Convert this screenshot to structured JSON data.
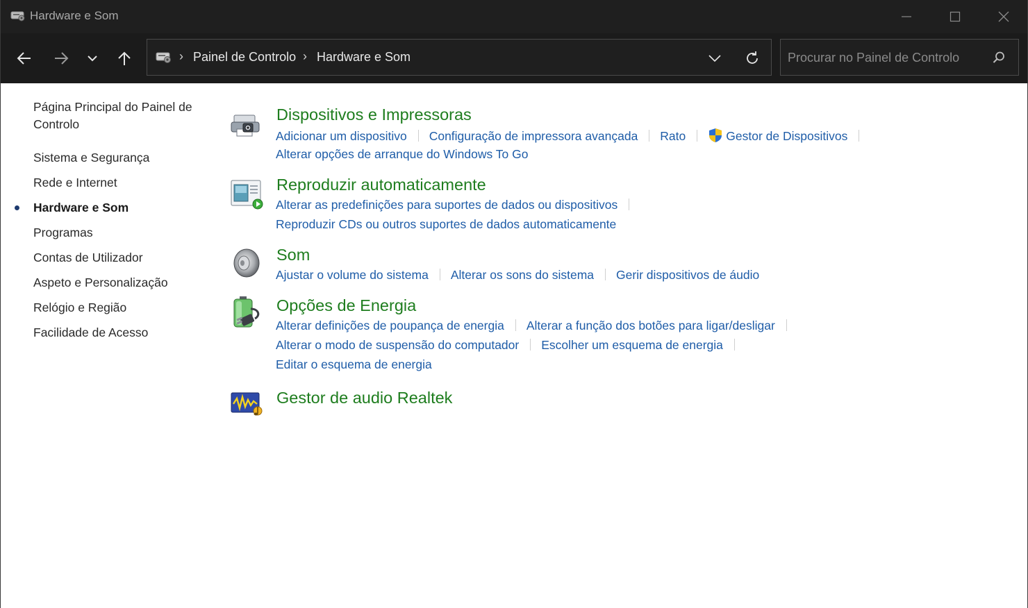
{
  "window": {
    "title": "Hardware e Som"
  },
  "address": {
    "crumbs": [
      "Painel de Controlo",
      "Hardware e Som"
    ],
    "separator": "›"
  },
  "search": {
    "placeholder": "Procurar no Painel de Controlo",
    "value": ""
  },
  "sidebar": {
    "home": "Página Principal do Painel de Controlo",
    "items": [
      {
        "label": "Sistema e Segurança",
        "active": false
      },
      {
        "label": "Rede e Internet",
        "active": false
      },
      {
        "label": "Hardware e Som",
        "active": true
      },
      {
        "label": "Programas",
        "active": false
      },
      {
        "label": "Contas de Utilizador",
        "active": false
      },
      {
        "label": "Aspeto e Personalização",
        "active": false
      },
      {
        "label": "Relógio e Região",
        "active": false
      },
      {
        "label": "Facilidade de Acesso",
        "active": false
      }
    ]
  },
  "categories": [
    {
      "title": "Dispositivos e Impressoras",
      "icon": "printer-devices-icon",
      "tasks": [
        "Adicionar um dispositivo",
        "Configuração de impressora avançada",
        "Rato",
        "Gestor de Dispositivos",
        "Alterar opções de arranque do Windows To Go"
      ]
    },
    {
      "title": "Reproduzir automaticamente",
      "icon": "autoplay-icon",
      "tasks": [
        "Alterar as predefinições para suportes de dados ou dispositivos",
        "Reproduzir CDs ou outros suportes de dados automaticamente"
      ]
    },
    {
      "title": "Som",
      "icon": "speaker-icon",
      "tasks": [
        "Ajustar o volume do sistema",
        "Alterar os sons do sistema",
        "Gerir dispositivos de áudio"
      ]
    },
    {
      "title": "Opções de Energia",
      "icon": "battery-plug-icon",
      "tasks": [
        "Alterar definições de poupança de energia",
        "Alterar a função dos botões para ligar/desligar",
        "Alterar o modo de suspensão do computador",
        "Escolher um esquema de energia",
        "Editar o esquema de energia"
      ]
    },
    {
      "title": "Gestor de audio Realtek",
      "icon": "realtek-audio-icon",
      "tasks": []
    }
  ],
  "colors": {
    "category_title": "#1e7d1e",
    "task_link": "#1f5da8",
    "titlebar": "#1f1f1f"
  }
}
